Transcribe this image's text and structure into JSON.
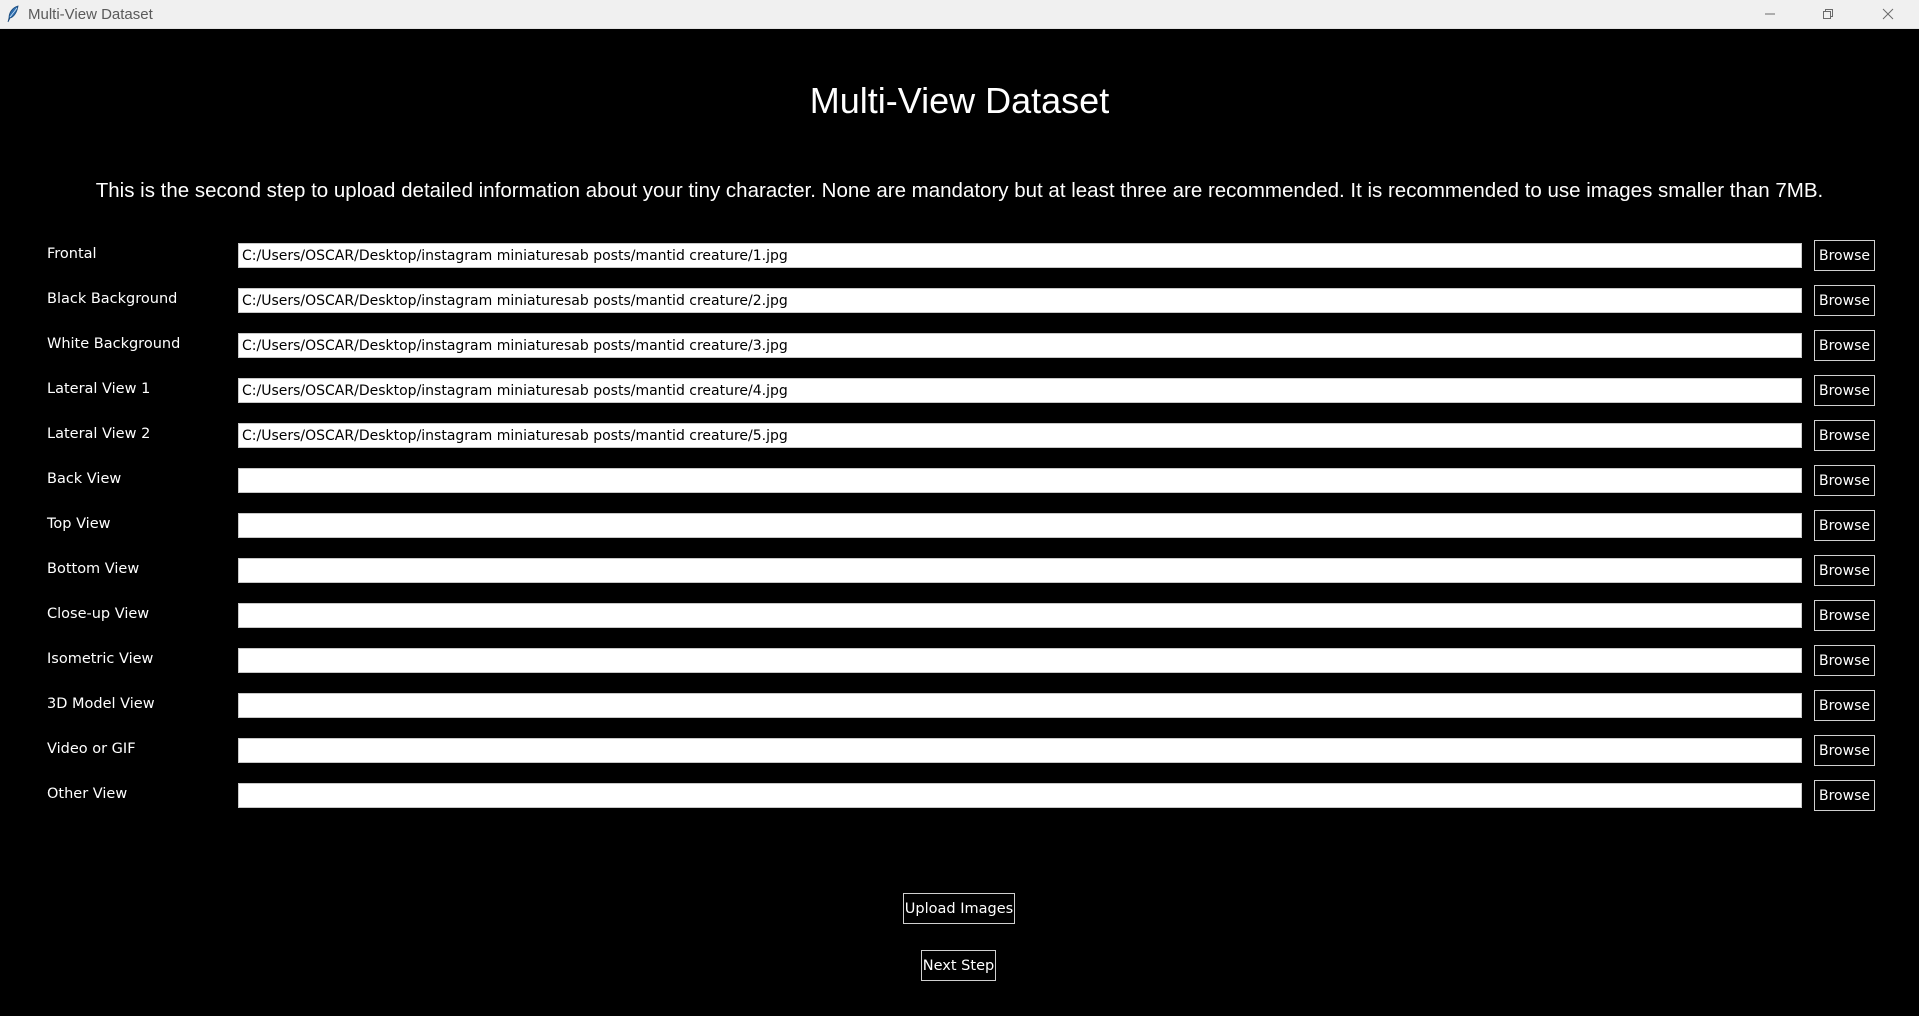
{
  "window": {
    "title": "Multi-View Dataset"
  },
  "heading": "Multi-View Dataset",
  "description": "This is the second step to upload detailed information about your tiny character. None are mandatory but at least three are recommended. It is recommended to use images smaller than 7MB.",
  "rows": [
    {
      "label": "Frontal",
      "value": "C:/Users/OSCAR/Desktop/instagram miniaturesab posts/mantid creature/1.jpg",
      "button": "Browse"
    },
    {
      "label": "Black Background",
      "value": "C:/Users/OSCAR/Desktop/instagram miniaturesab posts/mantid creature/2.jpg",
      "button": "Browse"
    },
    {
      "label": "White Background",
      "value": "C:/Users/OSCAR/Desktop/instagram miniaturesab posts/mantid creature/3.jpg",
      "button": "Browse"
    },
    {
      "label": "Lateral View 1",
      "value": "C:/Users/OSCAR/Desktop/instagram miniaturesab posts/mantid creature/4.jpg",
      "button": "Browse"
    },
    {
      "label": "Lateral View 2",
      "value": "C:/Users/OSCAR/Desktop/instagram miniaturesab posts/mantid creature/5.jpg",
      "button": "Browse"
    },
    {
      "label": "Back View",
      "value": "",
      "button": "Browse"
    },
    {
      "label": "Top View",
      "value": "",
      "button": "Browse"
    },
    {
      "label": "Bottom View",
      "value": "",
      "button": "Browse"
    },
    {
      "label": "Close-up View",
      "value": "",
      "button": "Browse"
    },
    {
      "label": "Isometric View",
      "value": "",
      "button": "Browse"
    },
    {
      "label": "3D Model View",
      "value": "",
      "button": "Browse"
    },
    {
      "label": "Video or GIF",
      "value": "",
      "button": "Browse"
    },
    {
      "label": "Other View",
      "value": "",
      "button": "Browse"
    }
  ],
  "actions": {
    "upload_label": "Upload Images",
    "next_label": "Next Step"
  },
  "icons": {
    "app": "feather-icon",
    "minimize": "minimize-icon",
    "maximize": "restore-icon",
    "close": "close-icon"
  }
}
